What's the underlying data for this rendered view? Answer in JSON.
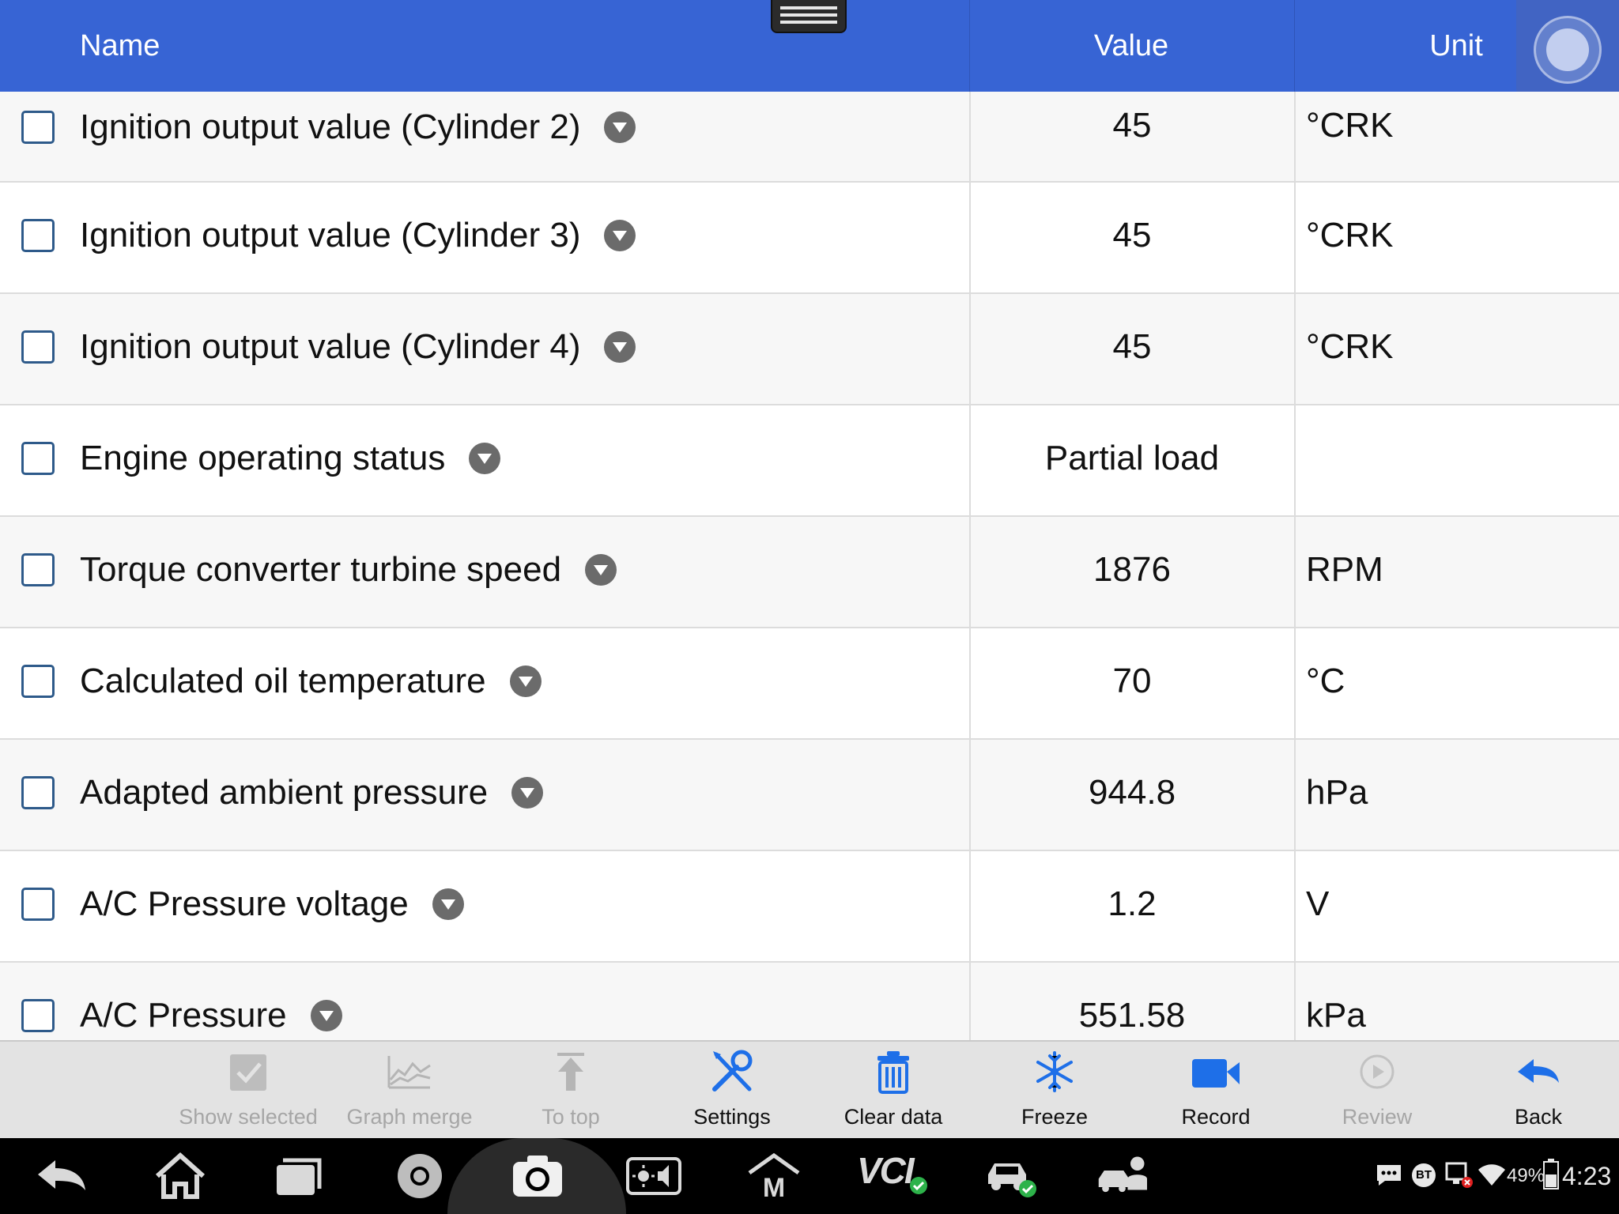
{
  "header": {
    "name": "Name",
    "value": "Value",
    "unit": "Unit"
  },
  "rows": [
    {
      "name": "Ignition output value (Cylinder 2)",
      "value": "45",
      "unit": "°CRK"
    },
    {
      "name": "Ignition output value (Cylinder 3)",
      "value": "45",
      "unit": "°CRK"
    },
    {
      "name": "Ignition output value (Cylinder 4)",
      "value": "45",
      "unit": "°CRK"
    },
    {
      "name": "Engine operating status",
      "value": "Partial load",
      "unit": ""
    },
    {
      "name": "Torque converter turbine speed",
      "value": "1876",
      "unit": "RPM"
    },
    {
      "name": "Calculated oil temperature",
      "value": "70",
      "unit": "°C"
    },
    {
      "name": "Adapted ambient pressure",
      "value": "944.8",
      "unit": "hPa"
    },
    {
      "name": "A/C Pressure voltage",
      "value": "1.2",
      "unit": "V"
    },
    {
      "name": "A/C Pressure",
      "value": "551.58",
      "unit": "kPa"
    }
  ],
  "toolbar": {
    "show_selected": "Show selected",
    "graph_merge": "Graph merge",
    "to_top": "To top",
    "settings": "Settings",
    "clear_data": "Clear data",
    "freeze": "Freeze",
    "record": "Record",
    "review": "Review",
    "back": "Back"
  },
  "status": {
    "bt": "BT",
    "battery": "49%",
    "time": "4:23",
    "vci": "VCI"
  },
  "colors": {
    "header_bg": "#3764d4",
    "accent_blue": "#1e6fe8",
    "disabled": "#a6a6a6"
  }
}
